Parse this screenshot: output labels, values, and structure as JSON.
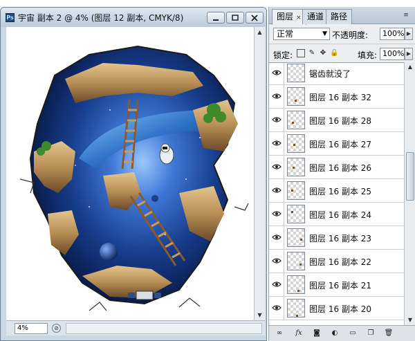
{
  "document": {
    "ps_badge": "Ps",
    "title": "宇宙 副本 2 @ 4% (图层 12 副本, CMYK/8)",
    "zoom": "4%",
    "window_buttons": [
      "minimize",
      "maximize",
      "close"
    ]
  },
  "panel": {
    "tabs": [
      {
        "label": "图层",
        "active": true
      },
      {
        "label": "通道",
        "active": false
      },
      {
        "label": "路径",
        "active": false
      }
    ],
    "tab_close": "×",
    "blend_mode": "正常",
    "opacity_label": "不透明度:",
    "opacity_value": "100%",
    "lock_label": "锁定:",
    "fill_label": "填充:",
    "fill_value": "100%",
    "layers": [
      {
        "name": "锯齿就没了",
        "visible": true
      },
      {
        "name": "图层 16 副本 32",
        "visible": true
      },
      {
        "name": "图层 16 副本 28",
        "visible": true
      },
      {
        "name": "图层 16 副本 27",
        "visible": true
      },
      {
        "name": "图层 16 副本 26",
        "visible": true
      },
      {
        "name": "图层 16 副本 25",
        "visible": true
      },
      {
        "name": "图层 16 副本 24",
        "visible": true
      },
      {
        "name": "图层 16 副本 23",
        "visible": true
      },
      {
        "name": "图层 16 副本 22",
        "visible": true
      },
      {
        "name": "图层 16 副本 21",
        "visible": true
      },
      {
        "name": "图层 16 副本 20",
        "visible": true
      }
    ],
    "footer_icons": [
      "link-icon",
      "fx-icon",
      "mask-icon",
      "adjustment-icon",
      "group-icon",
      "new-layer-icon",
      "trash-icon"
    ]
  },
  "colors": {
    "titlebar": "#c9d6e3",
    "space_blue": "#1b3f8a",
    "rock_tan": "#c9a56a"
  }
}
